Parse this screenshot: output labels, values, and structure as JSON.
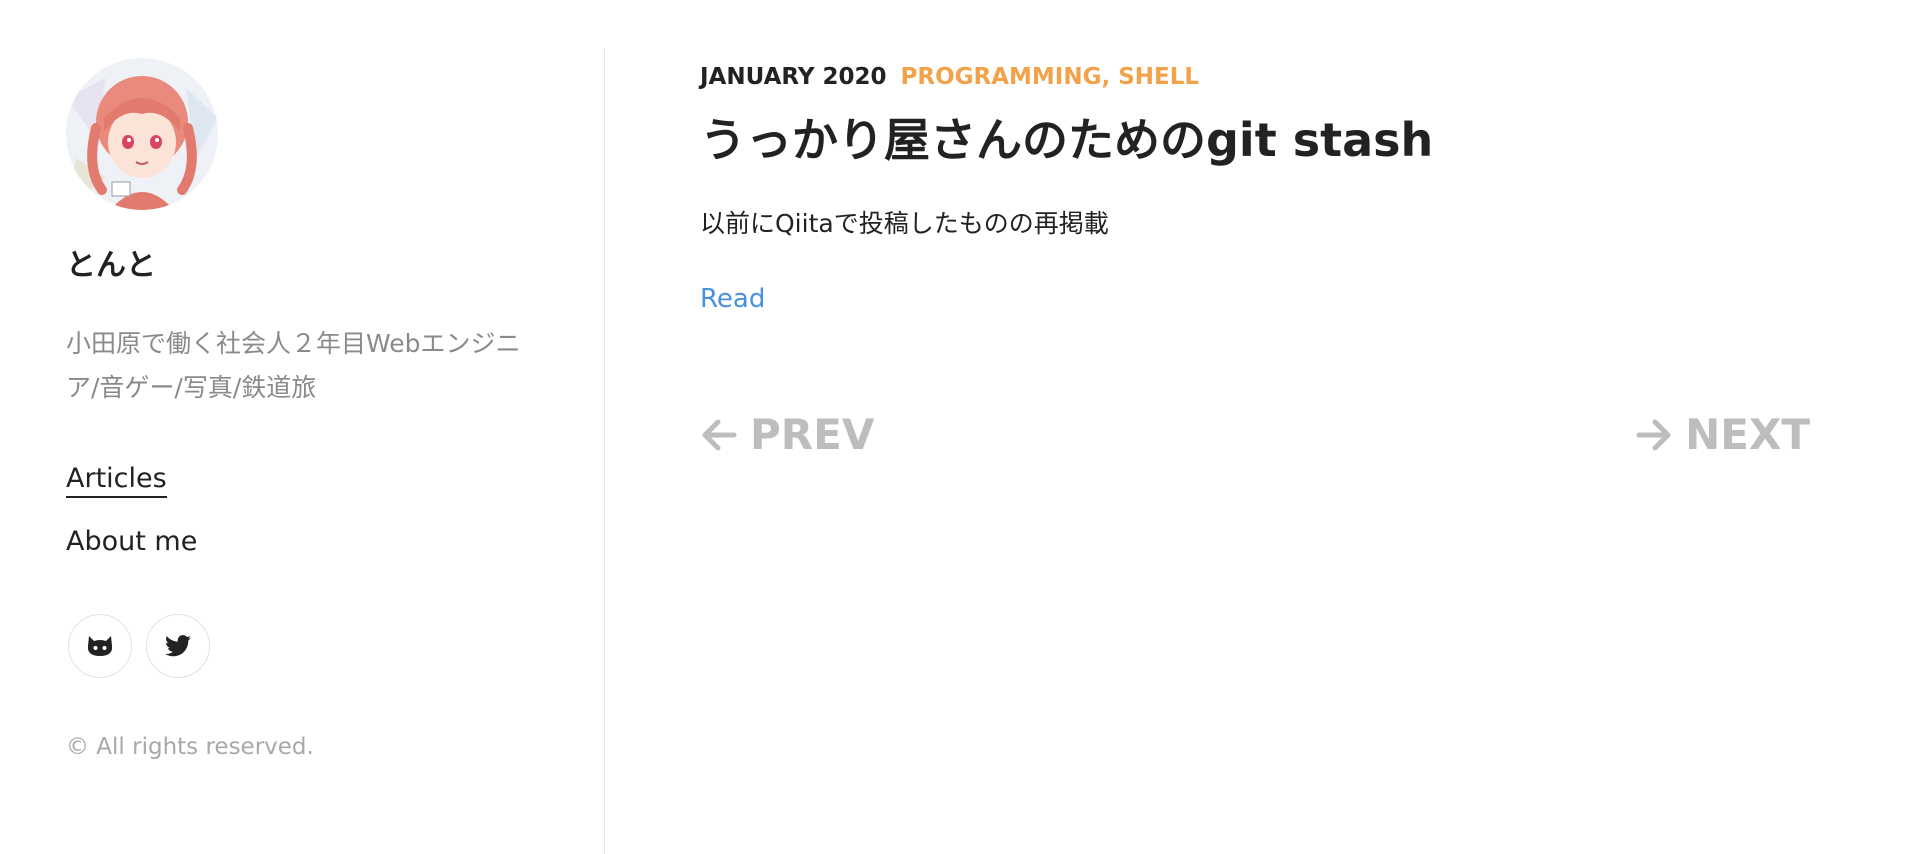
{
  "sidebar": {
    "author_name": "とんと",
    "bio": "小田原で働く社会人２年目Webエンジニア/音ゲー/写真/鉄道旅",
    "nav": [
      {
        "label": "Articles",
        "active": true
      },
      {
        "label": "About me",
        "active": false
      }
    ],
    "social": [
      {
        "icon": "github-icon"
      },
      {
        "icon": "twitter-icon"
      }
    ],
    "copyright": "© All rights reserved."
  },
  "post": {
    "date": "JANUARY 2020",
    "tags": "PROGRAMMING, SHELL",
    "title": "うっかり屋さんのためのgit stash",
    "excerpt": "以前にQiitaで投稿したものの再掲載",
    "read_label": "Read"
  },
  "pager": {
    "prev_label": "PREV",
    "next_label": "NEXT"
  },
  "colors": {
    "accent_tags": "#f2a24a",
    "link": "#4a90e2",
    "pager": "#bdbdbd"
  }
}
